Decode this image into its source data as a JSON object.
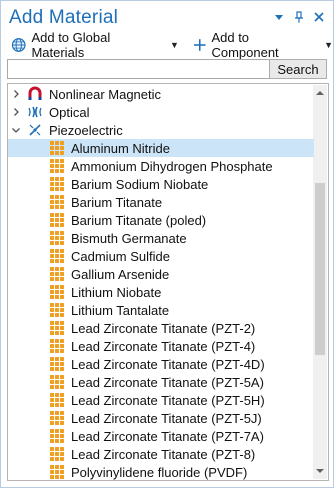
{
  "window": {
    "title": "Add Material",
    "pin_icon": "pin-icon",
    "close_icon": "close-icon"
  },
  "toolbar": {
    "add_global_label": "Add to Global Materials",
    "add_global_icon": "globe-icon",
    "add_component_label": "Add to Component",
    "add_component_icon": "plus-icon"
  },
  "search": {
    "value": "",
    "placeholder": "",
    "button_label": "Search"
  },
  "tree": {
    "categories": [
      {
        "label": "Nonlinear Magnetic",
        "icon": "magnet-icon",
        "expanded": false
      },
      {
        "label": "Optical",
        "icon": "optical-icon",
        "expanded": false
      },
      {
        "label": "Piezoelectric",
        "icon": "piezoelectric-icon",
        "expanded": true
      }
    ],
    "materials": [
      "Aluminum Nitride",
      "Ammonium Dihydrogen Phosphate",
      "Barium Sodium Niobate",
      "Barium Titanate",
      "Barium Titanate (poled)",
      "Bismuth Germanate",
      "Cadmium Sulfide",
      "Gallium Arsenide",
      "Lithium Niobate",
      "Lithium Tantalate",
      "Lead Zirconate Titanate (PZT-2)",
      "Lead Zirconate Titanate (PZT-4)",
      "Lead Zirconate Titanate (PZT-4D)",
      "Lead Zirconate Titanate (PZT-5A)",
      "Lead Zirconate Titanate (PZT-5H)",
      "Lead Zirconate Titanate (PZT-5J)",
      "Lead Zirconate Titanate (PZT-7A)",
      "Lead Zirconate Titanate (PZT-8)",
      "Polyvinylidene fluoride (PVDF)"
    ],
    "selected_index": 0,
    "material_icon": "material-grid-icon"
  },
  "colors": {
    "title": "#1d6fb8",
    "selection": "#cce4f7",
    "material_icon": "#f0a020"
  }
}
